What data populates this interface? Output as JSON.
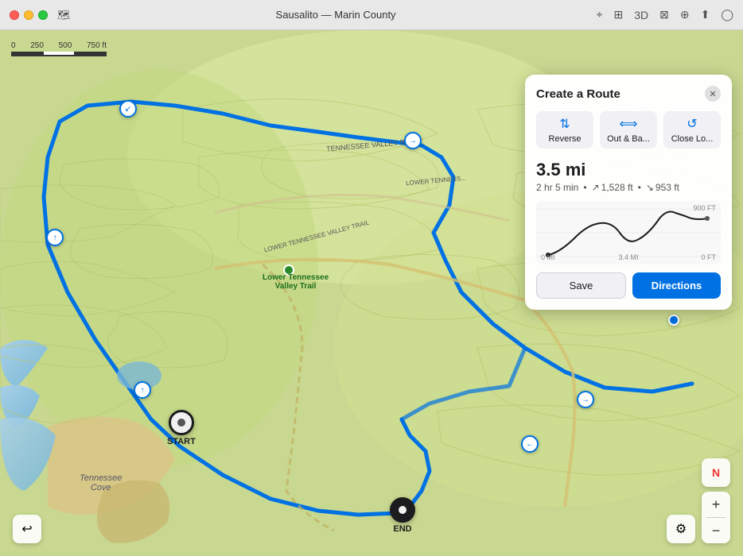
{
  "titlebar": {
    "title": "Sausalito — Marin County",
    "window_icon": "🗺",
    "actions": [
      "location-icon",
      "layers-icon",
      "3d-label",
      "share-icon",
      "zoom-in-icon",
      "share-box-icon",
      "user-icon"
    ]
  },
  "scale": {
    "labels": [
      "0",
      "250",
      "500",
      "750 ft"
    ]
  },
  "panel": {
    "title": "Create a Route",
    "close_label": "✕",
    "reverse_label": "Reverse",
    "out_back_label": "Out & Ba...",
    "close_loop_label": "Close Lo...",
    "distance": "3.5 mi",
    "time": "2 hr 5 min",
    "elevation_gain": "1,528 ft",
    "elevation_loss": "953 ft",
    "elevation_max_label": "900 FT",
    "elevation_zero_label": "0 FT",
    "distance_start_label": "0 MI",
    "distance_mid_label": "3.4 MI",
    "save_label": "Save",
    "directions_label": "Directions"
  },
  "markers": {
    "start_label": "START",
    "end_label": "END"
  },
  "map_labels": {
    "tennessee_valley_rd": "TENNESSEE VALLEY RD",
    "lower_tennessee": "LOWER TENNESS...",
    "lower_tennessee_valley_trail": "LOWER TENNESSEE VALLEY TRAIL",
    "poi_name": "Lower Tennessee\nValley Trail",
    "tennessee_cove": "Tennessee\nCove"
  },
  "bottom_controls": {
    "back_label": "←",
    "zoom_in": "+",
    "zoom_out": "−",
    "compass": "N"
  }
}
